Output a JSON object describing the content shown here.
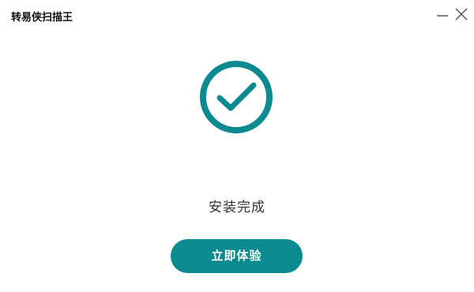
{
  "window": {
    "title": "转易侠扫描王",
    "controls": {
      "minimize_icon": "minimize-icon",
      "close_icon": "close-icon"
    }
  },
  "main": {
    "icon": "check-circle-icon",
    "status_text": "安装完成",
    "action_button_label": "立即体验"
  },
  "colors": {
    "accent": "#0b8a8f",
    "text": "#333333",
    "background": "#ffffff"
  }
}
